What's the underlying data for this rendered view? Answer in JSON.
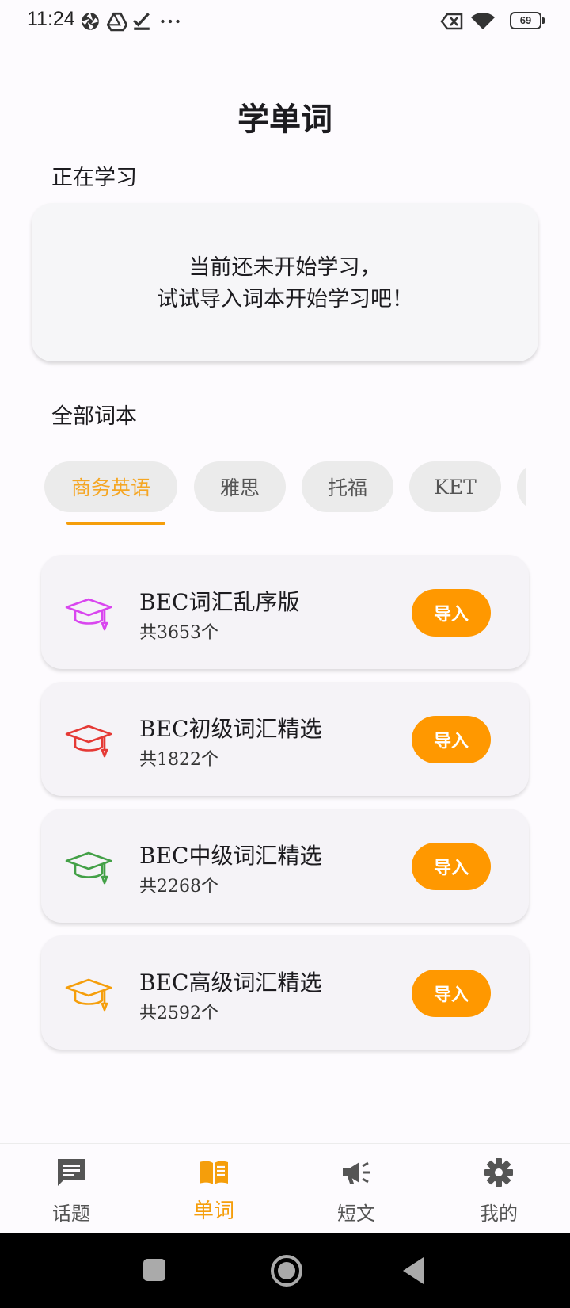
{
  "status_bar": {
    "time": "11:24",
    "battery": "69",
    "icons": [
      "aperture-icon",
      "drive-icon",
      "task-check-icon",
      "more-dots-icon",
      "sim-off-icon",
      "wifi-icon",
      "battery-icon"
    ]
  },
  "title": "学单词",
  "current": {
    "label": "正在学习",
    "empty_line1": "当前还未开始学习，",
    "empty_line2": "试试导入词本开始学习吧！"
  },
  "all_books": {
    "label": "全部词本",
    "tabs": [
      {
        "label": "商务英语",
        "active": true
      },
      {
        "label": "雅思",
        "active": false
      },
      {
        "label": "托福",
        "active": false
      },
      {
        "label": "KET",
        "active": false
      }
    ],
    "books": [
      {
        "title": "BEC词汇乱序版",
        "count": "共3653个",
        "button": "导入",
        "icon": "graduation-cap-icon",
        "color": "#d946ef"
      },
      {
        "title": "BEC初级词汇精选",
        "count": "共1822个",
        "button": "导入",
        "icon": "graduation-cap-icon",
        "color": "#e53935"
      },
      {
        "title": "BEC中级词汇精选",
        "count": "共2268个",
        "button": "导入",
        "icon": "graduation-cap-icon",
        "color": "#43a047"
      },
      {
        "title": "BEC高级词汇精选",
        "count": "共2592个",
        "button": "导入",
        "icon": "graduation-cap-icon",
        "color": "#f59e0b"
      }
    ]
  },
  "bottom_nav": [
    {
      "label": "话题",
      "icon": "chat-icon",
      "active": false
    },
    {
      "label": "单词",
      "icon": "book-icon",
      "active": true
    },
    {
      "label": "短文",
      "icon": "megaphone-icon",
      "active": false
    },
    {
      "label": "我的",
      "icon": "gear-icon",
      "active": false
    }
  ],
  "colors": {
    "accent": "#ff9800",
    "background": "#fdfbfe",
    "card": "#f5f3f7"
  }
}
